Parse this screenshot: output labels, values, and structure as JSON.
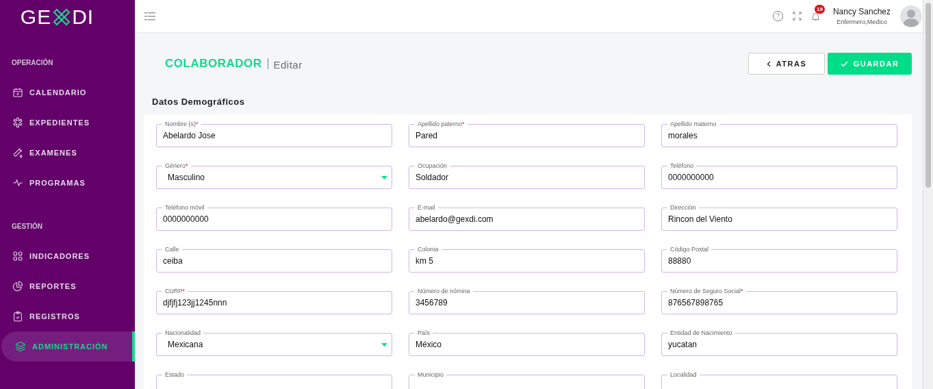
{
  "brand": {
    "logo_left": "GE",
    "logo_right": "DI"
  },
  "sidebar": {
    "sections": [
      {
        "title": "OPERACIÓN",
        "items": [
          {
            "label": "CALENDARIO",
            "selected": false
          },
          {
            "label": "EXPEDIENTES",
            "selected": false
          },
          {
            "label": "EXAMENES",
            "selected": false
          },
          {
            "label": "PROGRAMAS",
            "selected": false
          }
        ]
      },
      {
        "title": "GESTIÓN",
        "items": [
          {
            "label": "INDICADORES",
            "selected": false
          },
          {
            "label": "REPORTES",
            "selected": false
          },
          {
            "label": "REGISTROS",
            "selected": false
          },
          {
            "label": "ADMINISTRACIÓN",
            "selected": true
          }
        ]
      }
    ]
  },
  "topbar": {
    "notifications": "19",
    "user": {
      "name": "Nancy Sanchez",
      "role": "Enfermero,Medico"
    }
  },
  "page": {
    "title": "COLABORADOR",
    "subtitle": "Editar",
    "buttons": [
      {
        "label": "ATRAS",
        "kind": "back"
      },
      {
        "label": "GUARDAR",
        "kind": "save"
      }
    ]
  },
  "section": {
    "title": "Datos Demográficos",
    "fields": [
      {
        "label": "Nombre (s)",
        "value": "Abelardo Jose",
        "required_mark": "*",
        "kind": "text"
      },
      {
        "label": "Apellido paterno",
        "value": "Pared",
        "required_mark": "*",
        "kind": "text"
      },
      {
        "label": "Apellido materno",
        "value": "morales",
        "kind": "text"
      },
      {
        "label": "Género",
        "value": "Masculino",
        "required_mark": "*",
        "kind": "select"
      },
      {
        "label": "Ocupación",
        "value": "Soldador",
        "kind": "text"
      },
      {
        "label": "Teléfono",
        "value": "0000000000",
        "kind": "text"
      },
      {
        "label": "Teléfono móvil",
        "value": "0000000000",
        "kind": "text"
      },
      {
        "label": "E-mail",
        "value": "abelardo@gexdi.com",
        "kind": "text"
      },
      {
        "label": "Dirección",
        "value": "Rincon del Viento",
        "kind": "text"
      },
      {
        "label": "Calle",
        "value": "ceiba",
        "kind": "text"
      },
      {
        "label": "Colonia",
        "value": "km 5",
        "kind": "text"
      },
      {
        "label": "Código Postal",
        "value": "88880",
        "kind": "text"
      },
      {
        "label": "CURP",
        "value": "djfjfj123jj1245nnn",
        "required_mark": "*",
        "kind": "text"
      },
      {
        "label": "Número de nómina",
        "value": "3456789",
        "kind": "text"
      },
      {
        "label": "Número de Seguro Social",
        "value": "876567898765",
        "required_mark": "*",
        "kind": "text"
      },
      {
        "label": "Nacionalidad",
        "value": "Mexicana",
        "kind": "select"
      },
      {
        "label": "País",
        "value": "México",
        "kind": "text"
      },
      {
        "label": "Entidad de Nacimiento",
        "value": "yucatan",
        "kind": "text"
      },
      {
        "label": "Estado",
        "kind": "text"
      },
      {
        "label": "Municipio",
        "kind": "text"
      },
      {
        "label": "Localidad",
        "kind": "text"
      }
    ]
  }
}
